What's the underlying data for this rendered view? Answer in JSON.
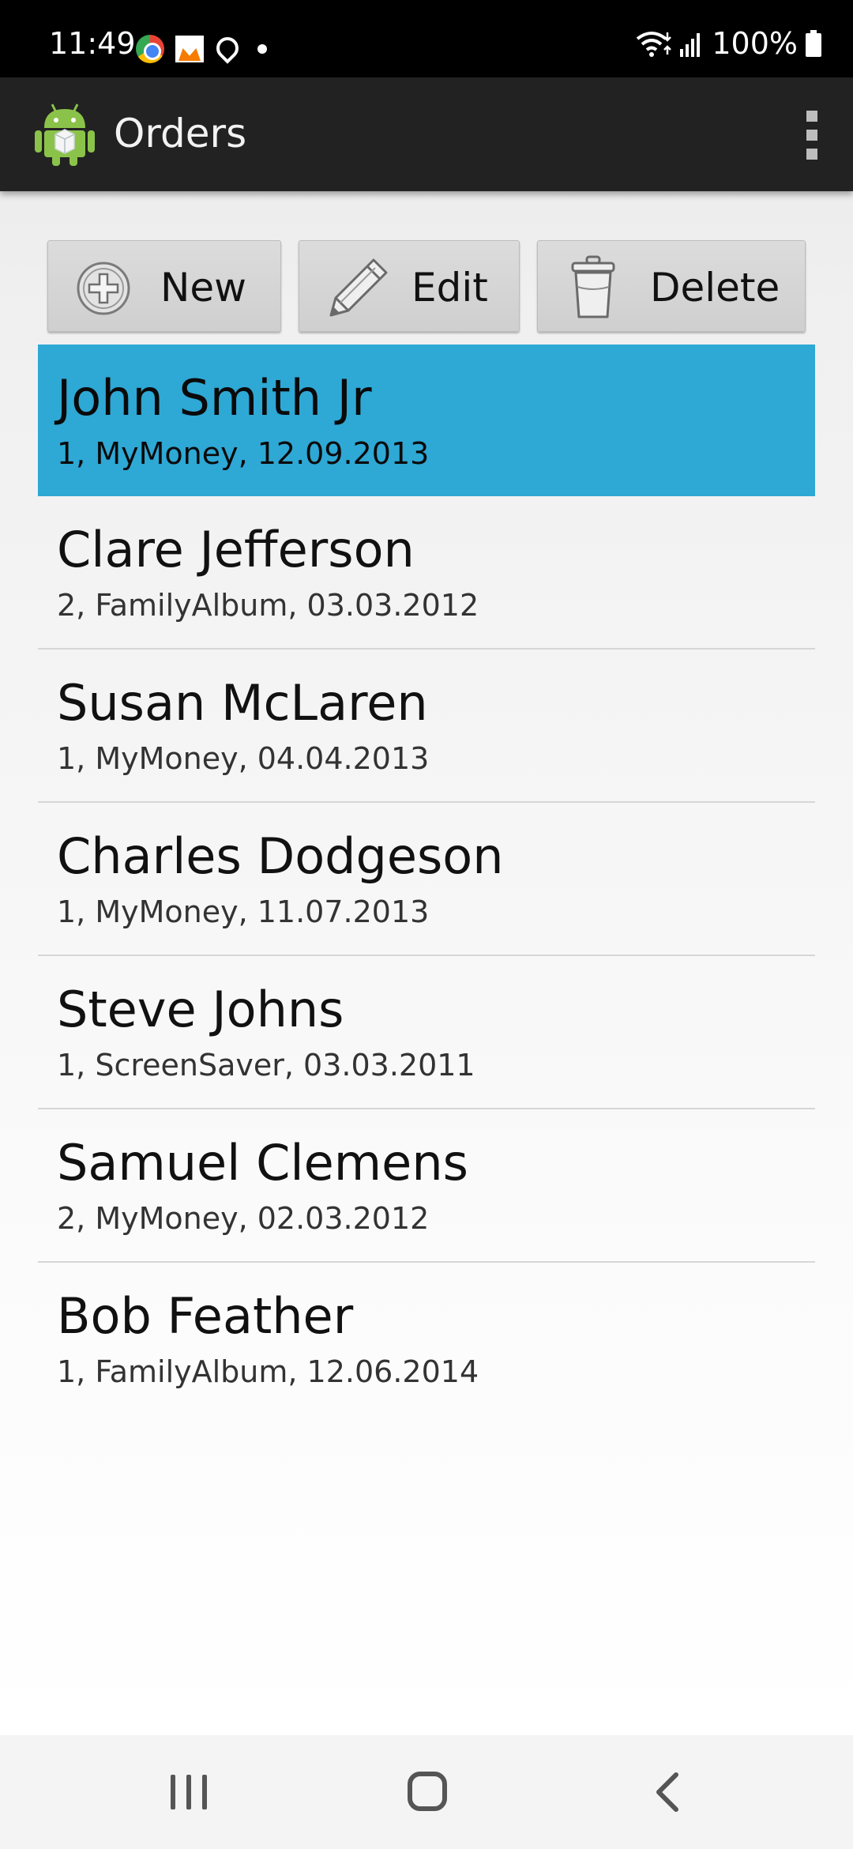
{
  "status_bar": {
    "time": "11:49",
    "battery_text": "100%",
    "icons": [
      "chrome-icon",
      "app-notification-icon",
      "location-icon",
      "dot-icon",
      "wifi-icon",
      "signal-icon",
      "battery-icon"
    ]
  },
  "app_bar": {
    "title": "Orders",
    "logo_icon": "android-logo-icon",
    "menu_icon": "overflow-menu-icon"
  },
  "toolbar": {
    "new_label": "New",
    "edit_label": "Edit",
    "delete_label": "Delete"
  },
  "orders": [
    {
      "name": "John Smith Jr",
      "detail": "1, MyMoney, 12.09.2013",
      "selected": true
    },
    {
      "name": "Clare Jefferson",
      "detail": "2, FamilyAlbum, 03.03.2012",
      "selected": false
    },
    {
      "name": "Susan McLaren",
      "detail": "1, MyMoney, 04.04.2013",
      "selected": false
    },
    {
      "name": "Charles Dodgeson",
      "detail": "1, MyMoney, 11.07.2013",
      "selected": false
    },
    {
      "name": "Steve Johns",
      "detail": "1, ScreenSaver, 03.03.2011",
      "selected": false
    },
    {
      "name": "Samuel Clemens",
      "detail": "2, MyMoney, 02.03.2012",
      "selected": false
    },
    {
      "name": "Bob Feather",
      "detail": "1, FamilyAlbum, 12.06.2014",
      "selected": false
    }
  ],
  "colors": {
    "selection": "#2ea8d5",
    "app_bar": "#222222",
    "status_bar": "#000000"
  }
}
